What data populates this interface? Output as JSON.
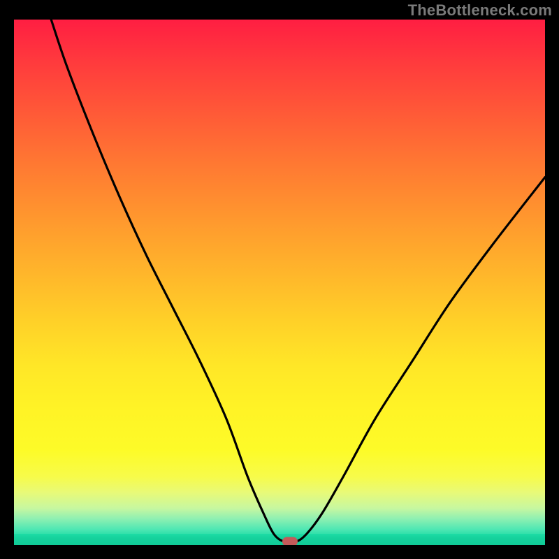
{
  "watermark": "TheBottleneck.com",
  "colors": {
    "frame_bg": "#000000",
    "curve_stroke": "#000000",
    "marker_fill": "#c45a5a",
    "gradient_top": "#ff1e42",
    "gradient_mid": "#ffe727",
    "gradient_bottom": "#0dd29b"
  },
  "chart_data": {
    "type": "line",
    "title": "",
    "xlabel": "",
    "ylabel": "",
    "xlim": [
      0,
      100
    ],
    "ylim": [
      0,
      100
    ],
    "grid": false,
    "legend": false,
    "series": [
      {
        "name": "bottleneck-curve",
        "x": [
          7,
          10,
          15,
          20,
          25,
          30,
          35,
          40,
          44,
          47,
          49,
          51,
          53,
          55,
          58,
          62,
          68,
          75,
          82,
          90,
          100
        ],
        "values": [
          100,
          91,
          78,
          66,
          55,
          45,
          35,
          24,
          13,
          6,
          2,
          0.6,
          0.6,
          2,
          6,
          13,
          24,
          35,
          46,
          57,
          70
        ]
      }
    ],
    "marker": {
      "x": 52,
      "y": 0.6
    },
    "annotations": [
      {
        "text": "TheBottleneck.com",
        "position": "top-right"
      }
    ]
  }
}
